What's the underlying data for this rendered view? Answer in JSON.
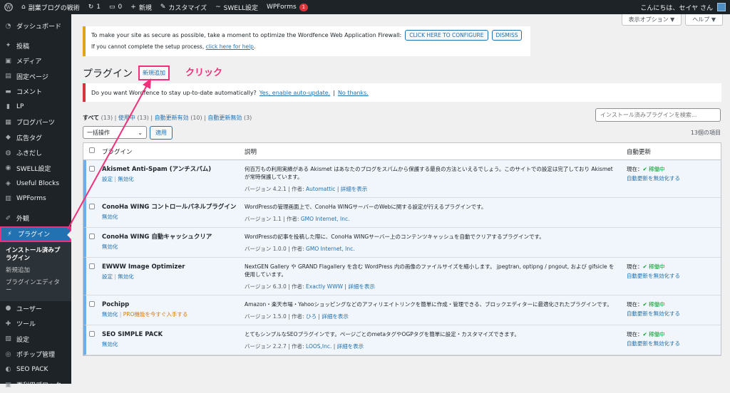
{
  "adminbar": {
    "site_name": "副業ブログの戦術",
    "updates_count": "1",
    "comments_count": "0",
    "new_label": "新規",
    "customize_label": "カスタマイズ",
    "swell_label": "SWELL設定",
    "wpforms_label": "WPForms",
    "wpforms_badge": "1",
    "greeting": "こんにちは、セイヤ さん"
  },
  "sidebar": {
    "items": [
      {
        "label": "ダッシュボード",
        "icon": "dashboard-icon"
      },
      {
        "label": "投稿",
        "icon": "pin-icon"
      },
      {
        "label": "メディア",
        "icon": "media-icon"
      },
      {
        "label": "固定ページ",
        "icon": "page-icon"
      },
      {
        "label": "コメント",
        "icon": "comment-icon"
      },
      {
        "label": "LP",
        "icon": "lp-icon"
      },
      {
        "label": "ブログパーツ",
        "icon": "parts-icon"
      },
      {
        "label": "広告タグ",
        "icon": "ad-tag-icon"
      },
      {
        "label": "ふきだし",
        "icon": "balloon-icon"
      },
      {
        "label": "SWELL設定",
        "icon": "swell-icon"
      },
      {
        "label": "Useful Blocks",
        "icon": "blocks-icon"
      },
      {
        "label": "WPForms",
        "icon": "forms-icon"
      },
      {
        "label": "外観",
        "icon": "appearance-icon"
      },
      {
        "label": "プラグイン",
        "icon": "plugin-icon"
      },
      {
        "label": "ユーザー",
        "icon": "user-icon"
      },
      {
        "label": "ツール",
        "icon": "tools-icon"
      },
      {
        "label": "設定",
        "icon": "settings-icon"
      },
      {
        "label": "ポチップ管理",
        "icon": "pochipp-icon"
      },
      {
        "label": "SEO PACK",
        "icon": "seo-icon"
      },
      {
        "label": "再利用ブロック",
        "icon": "reuse-icon"
      }
    ],
    "submenu": [
      "インストール済みプラグイン",
      "新規追加",
      "プラグインエディター"
    ]
  },
  "screen_options": {
    "options_label": "表示オプション ▼",
    "help_label": "ヘルプ ▼"
  },
  "wordfence_notice": {
    "text": "To make your site as secure as possible, take a moment to optimize the Wordfence Web Application Firewall:",
    "configure_label": "CLICK HERE TO CONFIGURE",
    "dismiss_label": "DISMISS",
    "help_prefix": "If you cannot complete the setup process, ",
    "help_link": "click here for help",
    "help_suffix": "."
  },
  "page": {
    "title": "プラグイン",
    "add_new_label": "新規追加",
    "annotation": "クリック"
  },
  "auto_update_notice": {
    "text": "Do you want Wordfence to stay up-to-date automatically?",
    "yes_label": "Yes, enable auto-update.",
    "separator": "|",
    "no_label": "No thanks."
  },
  "filters": {
    "all": "すべて",
    "all_count": "(13)",
    "active": "使用中",
    "active_count": "(13)",
    "auto_on": "自動更新有効",
    "auto_on_count": "(10)",
    "auto_off": "自動更新無効",
    "auto_off_count": "(3)",
    "sep": "|"
  },
  "search": {
    "placeholder": "インストール済みプラグインを検索..."
  },
  "bulk": {
    "select_label": "一括操作",
    "apply_label": "適用"
  },
  "item_count": "13個の項目",
  "table": {
    "headers": {
      "name": "プラグイン",
      "description": "説明",
      "auto_update": "自動更新"
    },
    "rows": [
      {
        "name": "Akismet Anti-Spam (アンチスパム)",
        "actions": [
          "設定",
          "無効化"
        ],
        "description": "何百万もの利用実績がある Akismet はあなたのブログをスパムから保護する最良の方法といえるでしょう。このサイトでの設定は完了しており Akismet が常時保護しています。",
        "version": "バージョン 4.2.1 | 作者: ",
        "author": "Automattic",
        "details": "詳細を表示",
        "auto_status": "現在：",
        "auto_on": "✔ 稼働中",
        "auto_link": "自動更新を無効化する"
      },
      {
        "name": "ConoHa WING コントロールパネルプラグイン",
        "actions": [
          "無効化"
        ],
        "description": "WordPressの管理画面上で、ConoHa WINGサーバーのWebに関する設定が行えるプラグインです。",
        "version": "バージョン 1.1 | 作者: ",
        "author": "GMO Internet, Inc.",
        "details": "",
        "auto_status": "",
        "auto_on": "",
        "auto_link": ""
      },
      {
        "name": "ConoHa WING 自動キャッシュクリア",
        "actions": [
          "無効化"
        ],
        "description": "WordPressの記事を投稿した際に、ConoHa WINGサーバー上のコンテンツキャッシュを自動でクリアするプラグインです。",
        "version": "バージョン 1.0.0 | 作者: ",
        "author": "GMO Internet, Inc.",
        "details": "",
        "auto_status": "",
        "auto_on": "",
        "auto_link": ""
      },
      {
        "name": "EWWW Image Optimizer",
        "actions": [
          "設定",
          "無効化"
        ],
        "description": "NextGEN Gallery や GRAND Flagallery を含む WordPress 内の画像のファイルサイズを縮小します。 jpegtran, optipng / pngout, および gifsicle を使用しています。",
        "version": "バージョン 6.3.0 | 作者: ",
        "author": "Exactly WWW",
        "details": "詳細を表示",
        "auto_status": "現在：",
        "auto_on": "✔ 稼働中",
        "auto_link": "自動更新を無効化する"
      },
      {
        "name": "Pochipp",
        "actions": [
          "無効化",
          "PRO機能を今すぐ入手する"
        ],
        "description": "Amazon・楽天市場・Yahooショッピングなどのアフィリエイトリンクを簡単に作成・管理できる、ブロックエディターに最適化されたプラグインです。",
        "version": "バージョン 1.5.0 | 作者: ",
        "author": "ひろ",
        "details": "詳細を表示",
        "auto_status": "現在：",
        "auto_on": "✔ 稼働中",
        "auto_link": "自動更新を無効化する"
      },
      {
        "name": "SEO SIMPLE PACK",
        "actions": [
          "無効化"
        ],
        "description": "とてもシンプルなSEOプラグインです。ページごとのmetaタグやOGPタグを簡単に設定・カスタマイズできます。",
        "version": "バージョン 2.2.7 | 作者: ",
        "author": "LOOS,Inc.",
        "details": "詳細を表示",
        "auto_status": "現在：",
        "auto_on": "✔ 稼働中",
        "auto_link": "自動更新を無効化する"
      }
    ]
  },
  "colors": {
    "accent": "#2271b1",
    "annotation": "#f0307a",
    "sidebar": "#1d2327"
  }
}
